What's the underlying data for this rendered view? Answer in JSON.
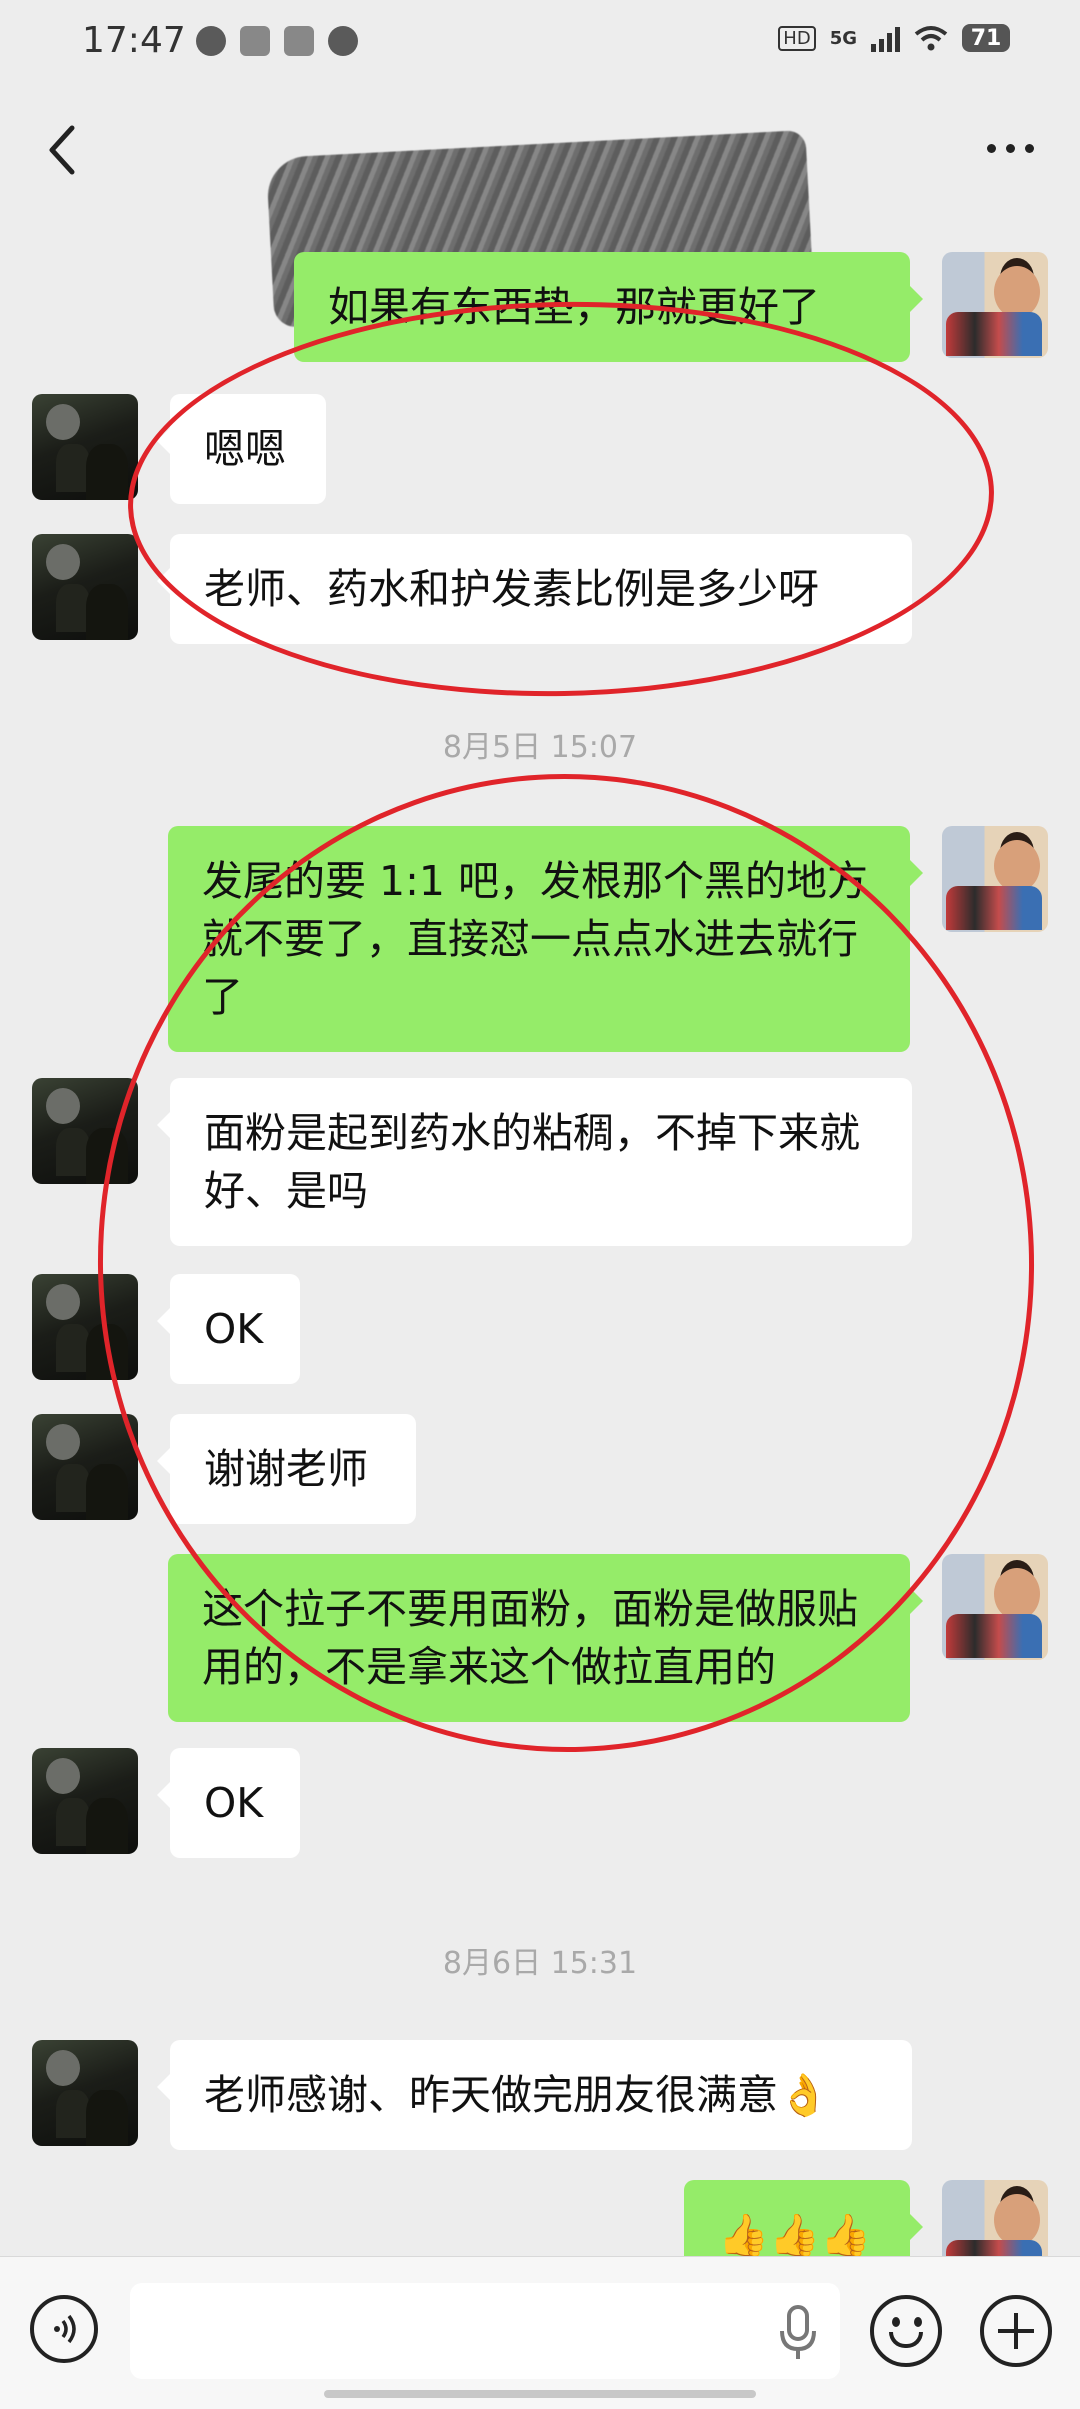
{
  "status_bar": {
    "time": "17:47",
    "network": "5G",
    "hd": "HD",
    "battery": "71"
  },
  "header": {
    "back_icon": "chevron-left-icon",
    "more_icon": "more-icon"
  },
  "messages": [
    {
      "side": "self",
      "text": "如果有东西垫，那就更好了"
    },
    {
      "side": "other",
      "text": "嗯嗯"
    },
    {
      "side": "other",
      "text": "老师、药水和护发素比例是多少呀"
    },
    {
      "timestamp": "8月5日 15:07"
    },
    {
      "side": "self",
      "text": "发尾的要 1:1 吧，发根那个黑的地方就不要了，直接怼一点点水进去就行了"
    },
    {
      "side": "other",
      "text": "面粉是起到药水的粘稠，不掉下来就好、是吗"
    },
    {
      "side": "other",
      "text": "OK"
    },
    {
      "side": "other",
      "text": "谢谢老师"
    },
    {
      "side": "self",
      "text": "这个拉子不要用面粉，面粉是做服贴用的，不是拿来这个做拉直用的"
    },
    {
      "side": "other",
      "text": "OK"
    },
    {
      "timestamp": "8月6日 15:31"
    },
    {
      "side": "other",
      "text": "老师感谢、昨天做完朋友很满意👌"
    },
    {
      "side": "self",
      "text": "👍👍👍"
    }
  ],
  "annotation_color": "#e0242a",
  "input_bar": {
    "voice_icon": "voice-icon",
    "mic_icon": "microphone-icon",
    "emoji_icon": "emoji-icon",
    "plus_icon": "plus-icon"
  },
  "colors": {
    "self_bubble": "#95ec69",
    "other_bubble": "#ffffff",
    "background": "#ededed"
  }
}
